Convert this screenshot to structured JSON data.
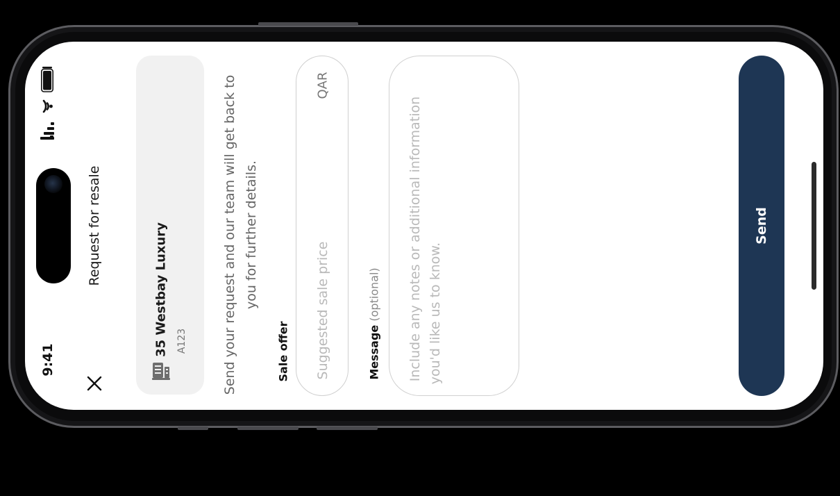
{
  "status_bar": {
    "time": "9:41"
  },
  "header": {
    "title": "Request for resale",
    "close_icon": "close-icon"
  },
  "property": {
    "name": "35 Westbay Luxury",
    "unit": "A123",
    "icon": "building-icon"
  },
  "description": {
    "line1": "Send your request and our team will get back to",
    "line2": "you for further details."
  },
  "sale_offer": {
    "label": "Sale offer",
    "placeholder": "Suggested sale price",
    "currency": "QAR",
    "value": ""
  },
  "message": {
    "label": "Message",
    "optional": "(optional)",
    "placeholder_line1": "Include any notes or additional information",
    "placeholder_line2": "you'd like us to know.",
    "value": ""
  },
  "send_button": {
    "label": "Send"
  },
  "colors": {
    "primary": "#1e3654",
    "card_bg": "#f1f1f1",
    "placeholder": "#b9b9b9",
    "body_text": "#666666"
  }
}
